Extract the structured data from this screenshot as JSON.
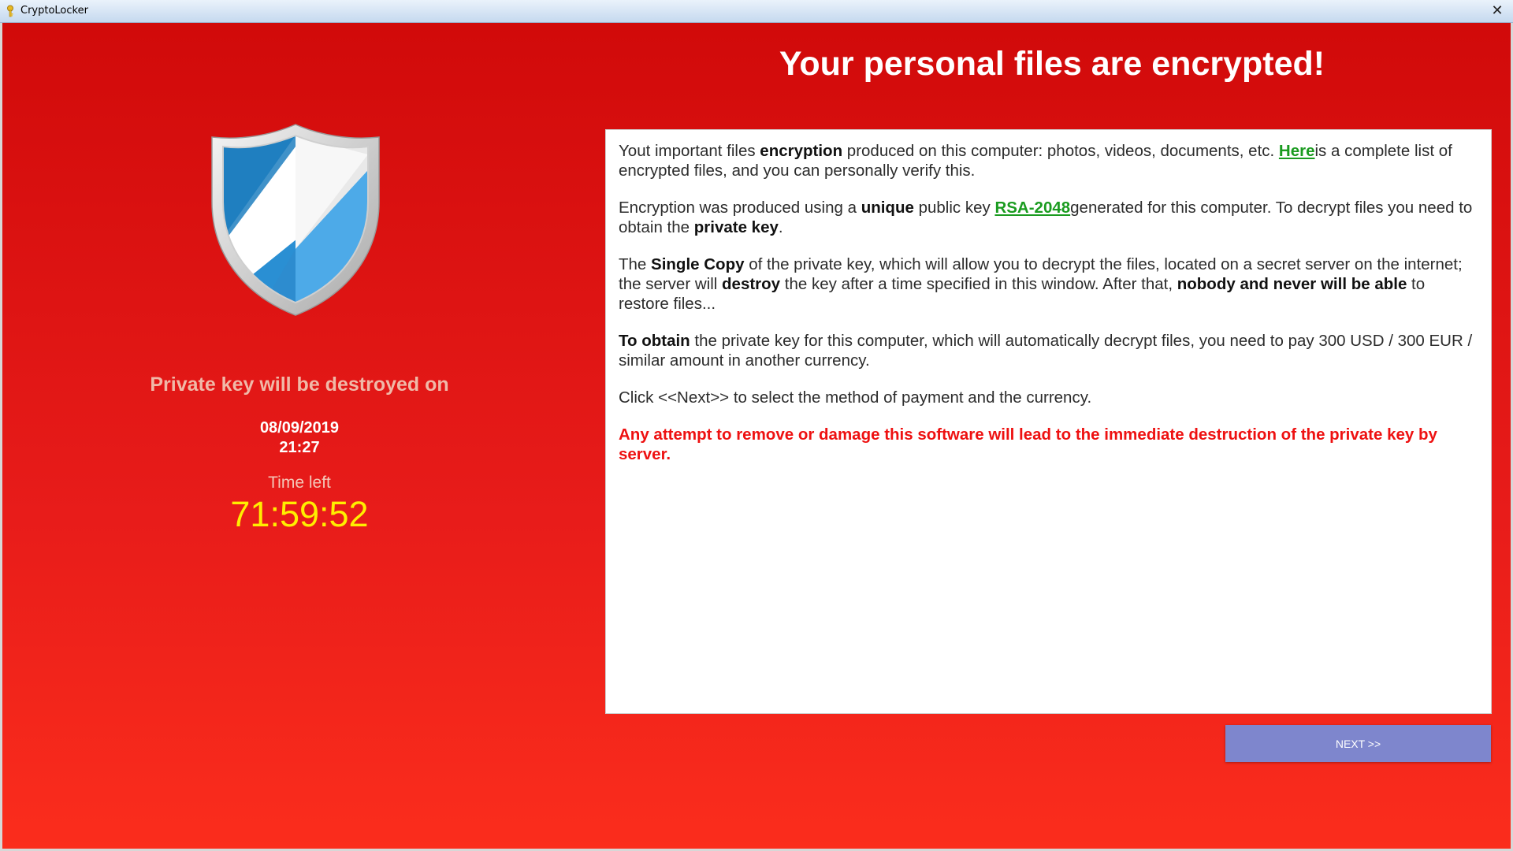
{
  "window": {
    "title": "CryptoLocker",
    "close_label": "✕"
  },
  "header": {
    "headline": "Your personal files are encrypted!"
  },
  "left_panel": {
    "icon": "shield-icon",
    "destroy_label": "Private key will be destroyed on",
    "destroy_date": "08/09/2019",
    "destroy_time": "21:27",
    "time_left_label": "Time left",
    "countdown": "71:59:52"
  },
  "message": {
    "p1_a": "Yout important files ",
    "p1_b": "encryption",
    "p1_c": " produced on this computer: photos, videos, documents, etc. ",
    "p1_link": "Here",
    "p1_d": "is a complete list of encrypted files, and you can personally verify this.",
    "p2_a": "Encryption was produced using a ",
    "p2_b": "unique",
    "p2_c": " public key ",
    "p2_link": "RSA-2048",
    "p2_d": "generated for this computer. To decrypt files you need to obtain the ",
    "p2_e": "private key",
    "p2_f": ".",
    "p3_a": "The ",
    "p3_b": "Single Copy",
    "p3_c": " of the private key, which will allow you to decrypt the files, located on a secret server on the internet; the server will ",
    "p3_d": "destroy",
    "p3_e": " the key after a time specified in this window. After that, ",
    "p3_f": "nobody and never will be able",
    "p3_g": " to restore files...",
    "p4_a": "To obtain",
    "p4_b": " the private key for this computer, which will automatically decrypt files, you need to pay 300 USD / 300 EUR / similar amount in another currency.",
    "p5": "Click <<Next>> to select the method of payment and the currency.",
    "p6": "Any attempt to remove or damage this software will lead to the immediate destruction of the private key by server."
  },
  "buttons": {
    "next_label": "NEXT >>"
  },
  "colors": {
    "background_top": "#d10a0a",
    "background_bottom": "#fb2d1c",
    "countdown": "#ffee00",
    "link": "#1a9b1f",
    "warning": "#ee1111",
    "next_button": "#7e86cd"
  }
}
